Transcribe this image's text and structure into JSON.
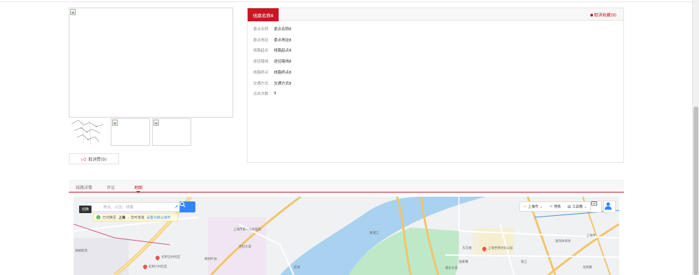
{
  "detail": {
    "route_name_tab": "线路名称8",
    "unfavorite": "取消收藏(9)",
    "info": [
      {
        "label": "景点名称",
        "value": "景点名称8"
      },
      {
        "label": "景点地址",
        "value": "景点地址8"
      },
      {
        "label": "线路起点",
        "value": "线路起点8"
      },
      {
        "label": "途径路线",
        "value": "途径路线8"
      },
      {
        "label": "线路终点",
        "value": "线路终点8"
      },
      {
        "label": "交通方式",
        "value": "交通方式8"
      },
      {
        "label": "点击次数",
        "value": "9"
      }
    ]
  },
  "gallery": {
    "unlike_button": "取消赞(9)"
  },
  "tabs": [
    {
      "label": "线路详情"
    },
    {
      "label": "评论"
    },
    {
      "label": "地图",
      "active": true
    }
  ],
  "map": {
    "search_placeholder": "地点、公交、线路",
    "switch_tip": "切换",
    "city_tip_prefix": "已切换至",
    "city_tip_city": "上海",
    "city_tip_middle": "，您可将其",
    "city_tip_link": "设置为默认城市",
    "controls": {
      "city": "上海市",
      "subway": "地铁",
      "toolbox": "工具箱"
    },
    "labels": [
      "海峰新苑",
      "虹桥五村社区",
      "虹桥六村社区",
      "保利叶语",
      "上海市第一人民医院",
      "上海世博文化公园",
      "东方路",
      "陆家嘴",
      "上海市",
      "源深体育场",
      "浦东大道",
      "龙阳路",
      "张江",
      "黄浦江",
      "世纪大道",
      "前滩"
    ]
  },
  "colors": {
    "accent": "#c81623",
    "map_blue": "#3385ff",
    "river": "#a8d2f0",
    "park": "#bfe8c8"
  }
}
